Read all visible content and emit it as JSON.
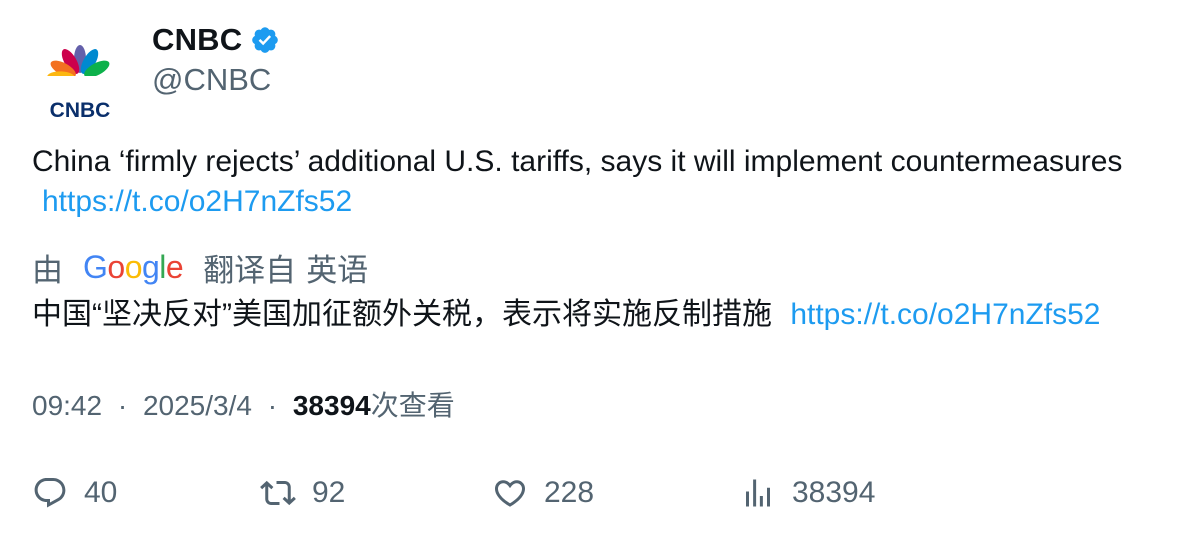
{
  "author": {
    "name": "CNBC",
    "handle": "@CNBC",
    "logo_text": "CNBC",
    "verified_color": "#1d9bf0"
  },
  "tweet": {
    "text": "China ‘firmly rejects’ additional U.S. tariffs, says it will implement countermeasures",
    "link": "https://t.co/o2H7nZfs52"
  },
  "translation": {
    "by_label": "由",
    "provider": "Google",
    "from_label": "翻译自",
    "language": "英语",
    "text": "中国“坚决反对”美国加征额外关税，表示将实施反制措施",
    "link": "https://t.co/o2H7nZfs52"
  },
  "meta": {
    "time": "09:42",
    "separator": "·",
    "date": "2025/3/4",
    "views": "38394",
    "views_suffix": "次查看"
  },
  "actions": {
    "replies": "40",
    "retweets": "92",
    "likes": "228",
    "views": "38394"
  },
  "colors": {
    "link": "#1d9bf0",
    "secondary_text": "#536471",
    "primary_text": "#0f1419"
  },
  "icons": [
    "cnbc-peacock-logo",
    "verified-badge-icon",
    "reply-icon",
    "retweet-icon",
    "like-icon",
    "views-icon"
  ]
}
